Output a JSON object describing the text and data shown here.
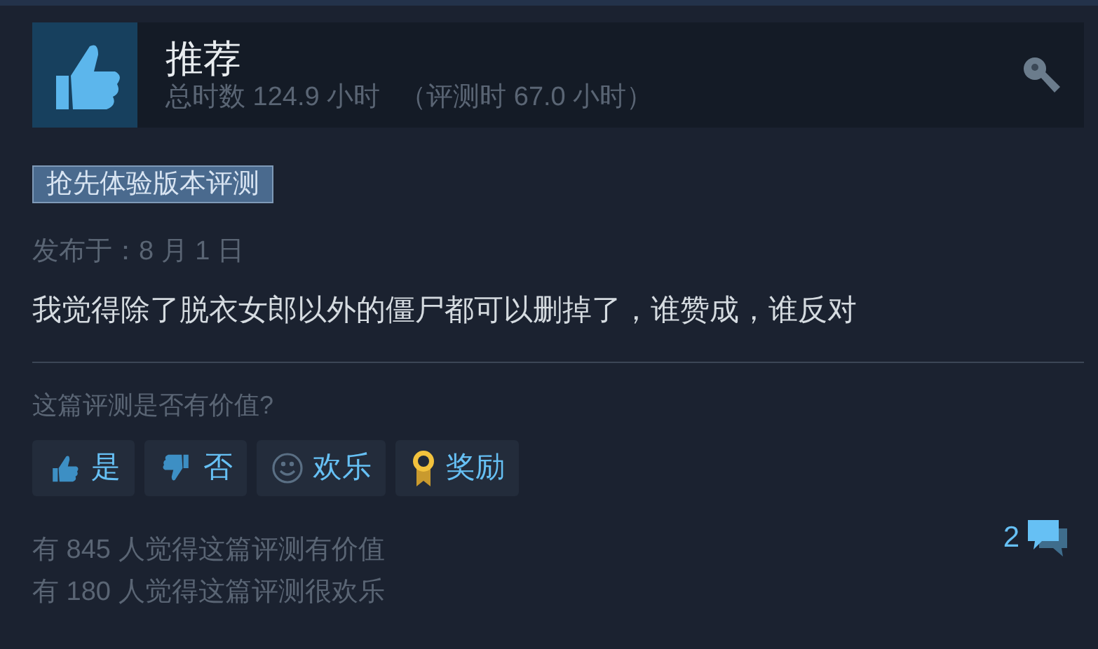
{
  "review": {
    "verdict": "推荐",
    "recommended": true,
    "hours": "总时数 124.9 小时",
    "review_hours": "（评测时 67.0 小时）",
    "badge": "抢先体验版本评测",
    "posted": "发布于：8 月 1 日",
    "text": "我觉得除了脱衣女郎以外的僵尸都可以删掉了，谁赞成，谁反对"
  },
  "helpful": {
    "question": "这篇评测是否有价值?",
    "buttons": [
      {
        "kind": "yes",
        "label": "是"
      },
      {
        "kind": "no",
        "label": "否"
      },
      {
        "kind": "funny",
        "label": "欢乐"
      },
      {
        "kind": "award",
        "label": "奖励"
      }
    ],
    "counts": [
      "有 845 人觉得这篇评测有价值",
      "有 180 人觉得这篇评测很欢乐"
    ],
    "comments": "2"
  }
}
